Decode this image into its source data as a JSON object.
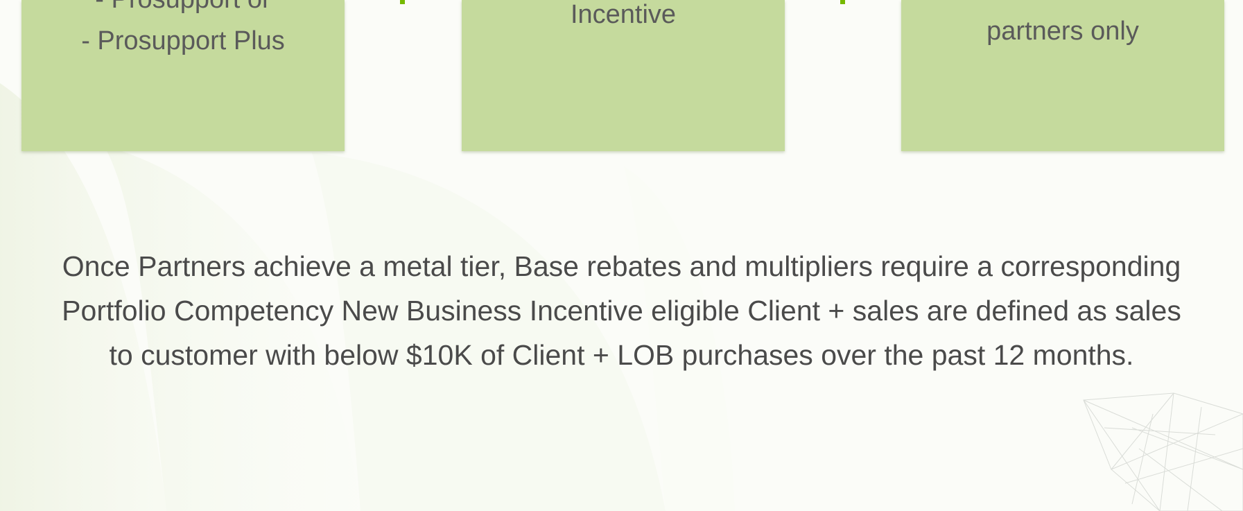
{
  "boxes": [
    {
      "lines": [
        "- Prosupport or",
        "- Prosupport Plus"
      ]
    },
    {
      "lines": [
        "Incentive"
      ]
    },
    {
      "lines": [
        "partners only"
      ]
    }
  ],
  "description": {
    "lines": [
      "Once Partners achieve a metal tier, Base rebates and multipliers require a corresponding",
      "Portfolio Competency New Business Incentive eligible Client + sales are defined as sales",
      "to customer with below $10K of Client + LOB purchases over the past 12 months."
    ]
  },
  "colors": {
    "box_fill": "#c5da9d",
    "accent_green": "#76b900",
    "text": "#4a4a4a"
  }
}
